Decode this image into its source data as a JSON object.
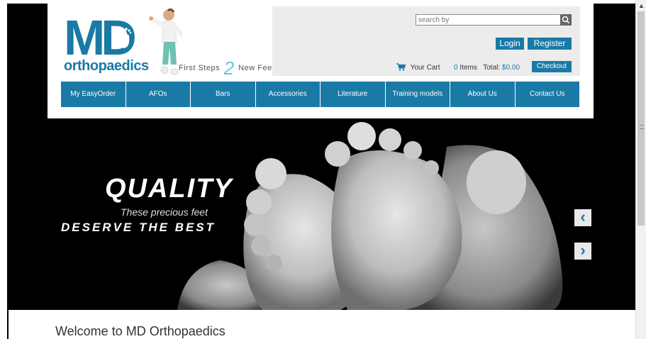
{
  "logo": {
    "brand": "MD",
    "name": "orthopaedics"
  },
  "tagline": {
    "part1": "First Steps",
    "two": "2",
    "part2": "New Feet"
  },
  "search": {
    "placeholder": "search by"
  },
  "auth": {
    "login": "Login",
    "register": "Register"
  },
  "cart": {
    "label": "Your Cart",
    "count": "0",
    "items_label": "Items",
    "total_label": "Total:",
    "total": "$0.00",
    "checkout": "Checkout"
  },
  "nav": [
    "My EasyOrder",
    "AFOs",
    "Bars",
    "Accessories",
    "Literature",
    "Training models",
    "About Us",
    "Contact Us"
  ],
  "hero": {
    "headline": "QUALITY",
    "line1": "These precious feet",
    "line2": "DESERVE THE BEST"
  },
  "content": {
    "welcome": "Welcome to MD Orthopaedics"
  },
  "colors": {
    "brand": "#1a7aa6",
    "accent_light": "#6cc3dc",
    "header_box": "#ececec"
  },
  "icons": {
    "search": "search-icon",
    "cart": "cart-icon",
    "prev": "chevron-left-icon",
    "next": "chevron-right-icon"
  }
}
